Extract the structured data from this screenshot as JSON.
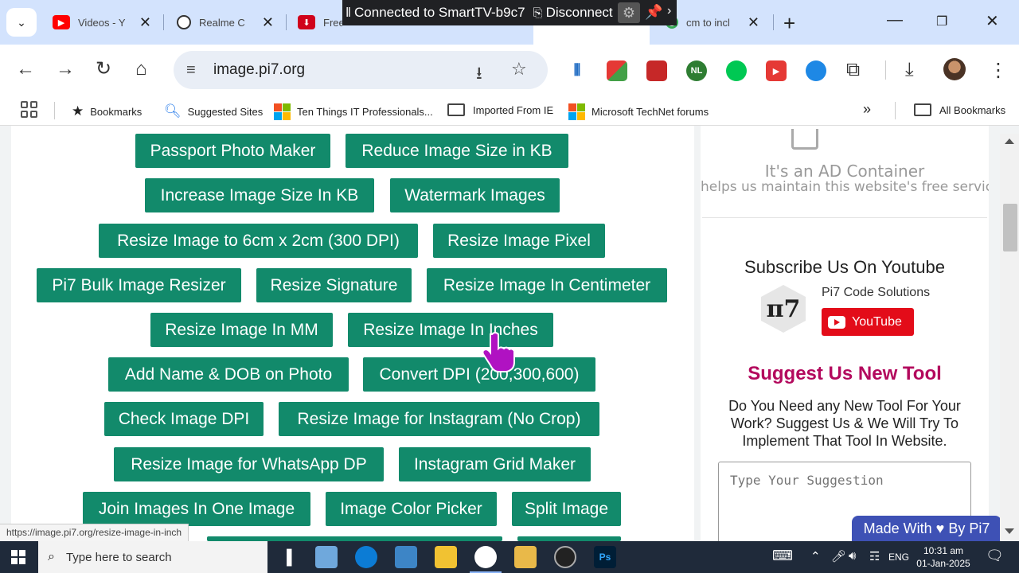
{
  "tabs": [
    {
      "title": "Videos - Y",
      "icon": "youtube-icon",
      "color": "#ff0000"
    },
    {
      "title": "Realme C",
      "icon": "chatgpt-icon",
      "color": "#333333"
    },
    {
      "title": "Free",
      "icon": "download-arrow-icon",
      "color": "#d0021b"
    },
    {
      "title": "",
      "icon": "whatsapp-icon",
      "color": "#25d366"
    },
    {
      "title": "cm to inch",
      "icon": "google-icon",
      "color": "#1a73e8"
    }
  ],
  "cast_bar": {
    "status": "Connected to SmartTV-b9c7",
    "disconnect": "Disconnect"
  },
  "omnibox": {
    "url": "image.pi7.org"
  },
  "bookmarks": [
    {
      "label": "Bookmarks",
      "icon": "star-icon"
    },
    {
      "label": "Suggested Sites",
      "icon": "search-icon"
    },
    {
      "label": "Ten Things IT Professionals...",
      "icon": "microsoft-logo-icon"
    },
    {
      "label": "Imported From IE",
      "icon": "folder-icon"
    },
    {
      "label": "Microsoft TechNet forums",
      "icon": "microsoft-logo-icon"
    },
    {
      "label": "All Bookmarks",
      "icon": "folder-icon"
    }
  ],
  "tools": [
    "Passport Photo Maker",
    "Reduce Image Size in KB",
    "Increase Image Size In KB",
    "Watermark Images",
    "Resize Image to 6cm x 2cm (300 DPI)",
    "Resize Image Pixel",
    "Pi7 Bulk Image Resizer",
    "Resize Signature",
    "Resize Image In Centimeter",
    "Resize Image In MM",
    "Resize Image In Inches",
    "Add Name & DOB on Photo",
    "Convert DPI (200,300,600)",
    "Check Image DPI",
    "Resize Image for Instagram (No Crop)",
    "Resize Image for WhatsApp DP",
    "Instagram Grid Maker",
    "Join Images In One Image",
    "Image Color Picker",
    "Split Image"
  ],
  "sidebar": {
    "ad_title": "It's an AD Container",
    "ad_subtitle": "helps us maintain this website's free servic",
    "subscribe_heading": "Subscribe Us On Youtube",
    "channel_name": "Pi7 Code Solutions",
    "youtube_button": "YouTube",
    "logo_text": "π7",
    "suggest_title": "Suggest Us New Tool",
    "suggest_description": "Do You Need any New Tool For Your Work? Suggest Us & We Will Try To Implement That Tool In Website.",
    "suggest_placeholder": "Type Your Suggestion",
    "made_with": "Made With ♥ By  Pi7"
  },
  "status_bar_url": "https://image.pi7.org/resize-image-in-inch",
  "taskbar": {
    "search_placeholder": "Type here to search",
    "language": "ENG",
    "time": "10:31 am",
    "date": "01-Jan-2025"
  },
  "colors": {
    "tool_button": "#128a6b",
    "suggest_title": "#b3095d",
    "made_with_badge": "#3e51b5",
    "youtube_red": "#e30c19"
  }
}
